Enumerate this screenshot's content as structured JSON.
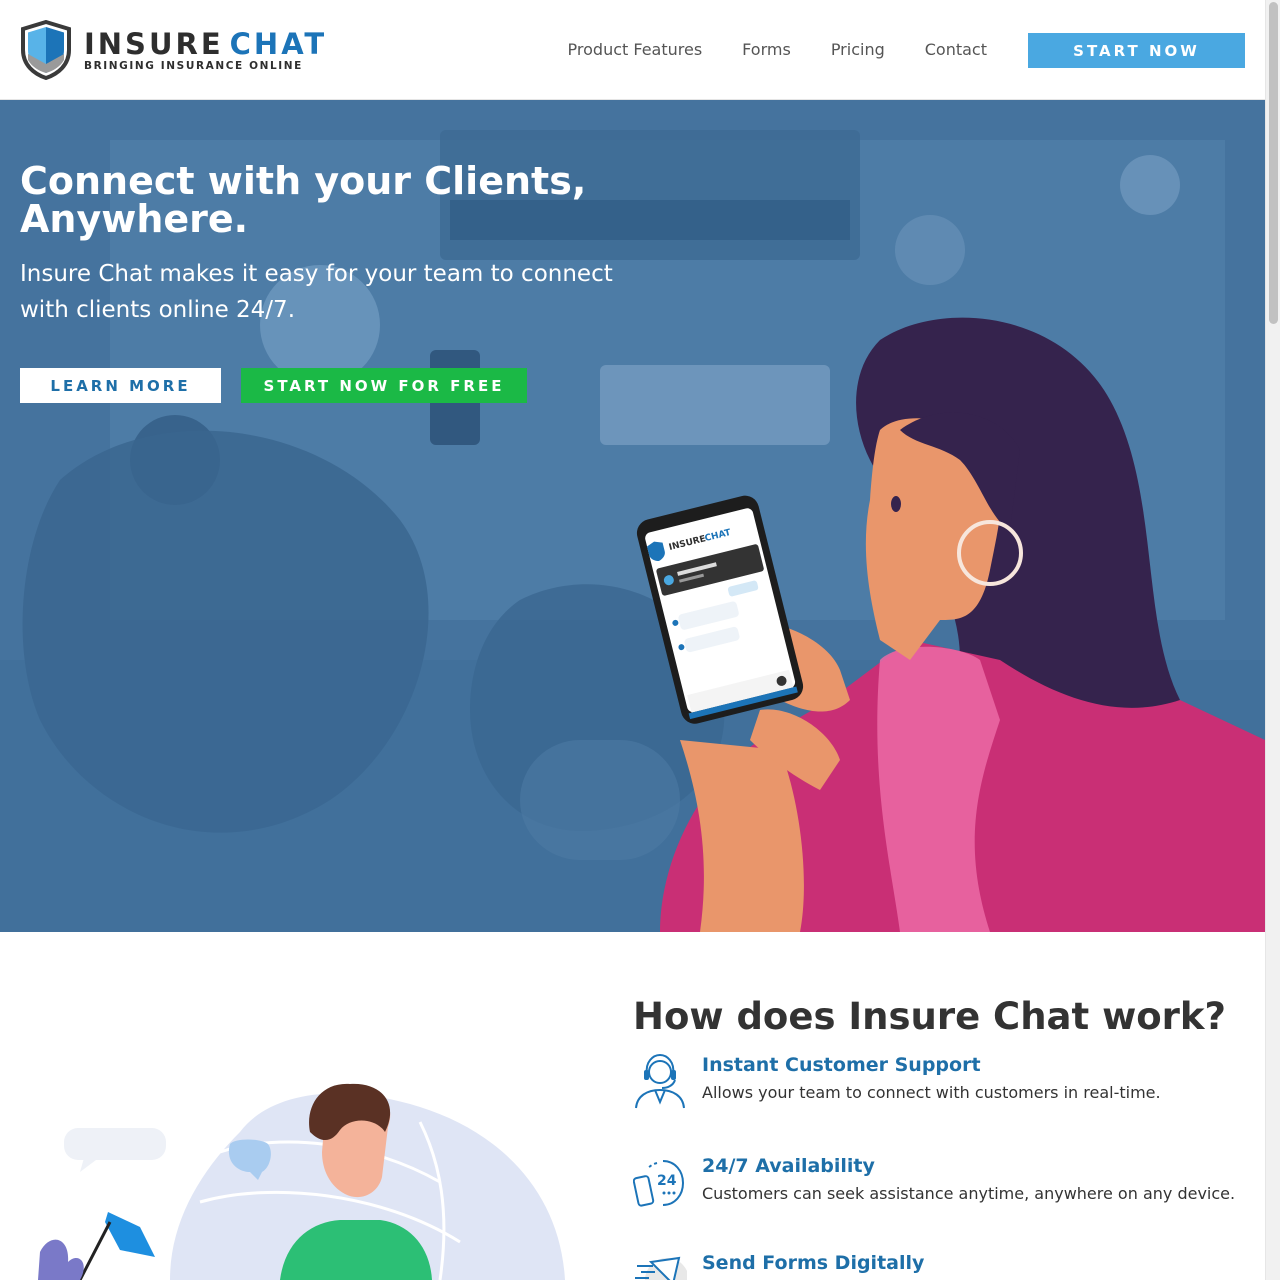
{
  "brand": {
    "name_part1": "INSURE",
    "name_part2": "CHAT",
    "tagline": "BRINGING INSURANCE ONLINE",
    "colors": {
      "primary": "#1c74b8",
      "dark": "#2e2e2e",
      "cta": "#4aa8e1",
      "green": "#1bb946"
    }
  },
  "nav": {
    "items": [
      "Product Features",
      "Forms",
      "Pricing",
      "Contact"
    ],
    "cta_label": "START NOW"
  },
  "hero": {
    "title": "Connect with your Clients, Anywhere.",
    "subtitle": "Insure Chat makes it easy for your team to connect with clients online 24/7.",
    "learn_more_label": "LEARN MORE",
    "start_free_label": "START NOW FOR FREE",
    "phone_logo_part1": "INSURE",
    "phone_logo_part2": "CHAT"
  },
  "how": {
    "title": "How does Insure Chat work?",
    "features": [
      {
        "icon": "customer-support-icon",
        "title": "Instant Customer Support",
        "description": "Allows your team to connect with customers in real-time."
      },
      {
        "icon": "availability-24-icon",
        "title": "24/7 Availability",
        "description": "Customers can seek assistance anytime, anywhere on any device."
      },
      {
        "icon": "send-forms-icon",
        "title": "Send Forms Digitally",
        "description": ""
      }
    ]
  }
}
